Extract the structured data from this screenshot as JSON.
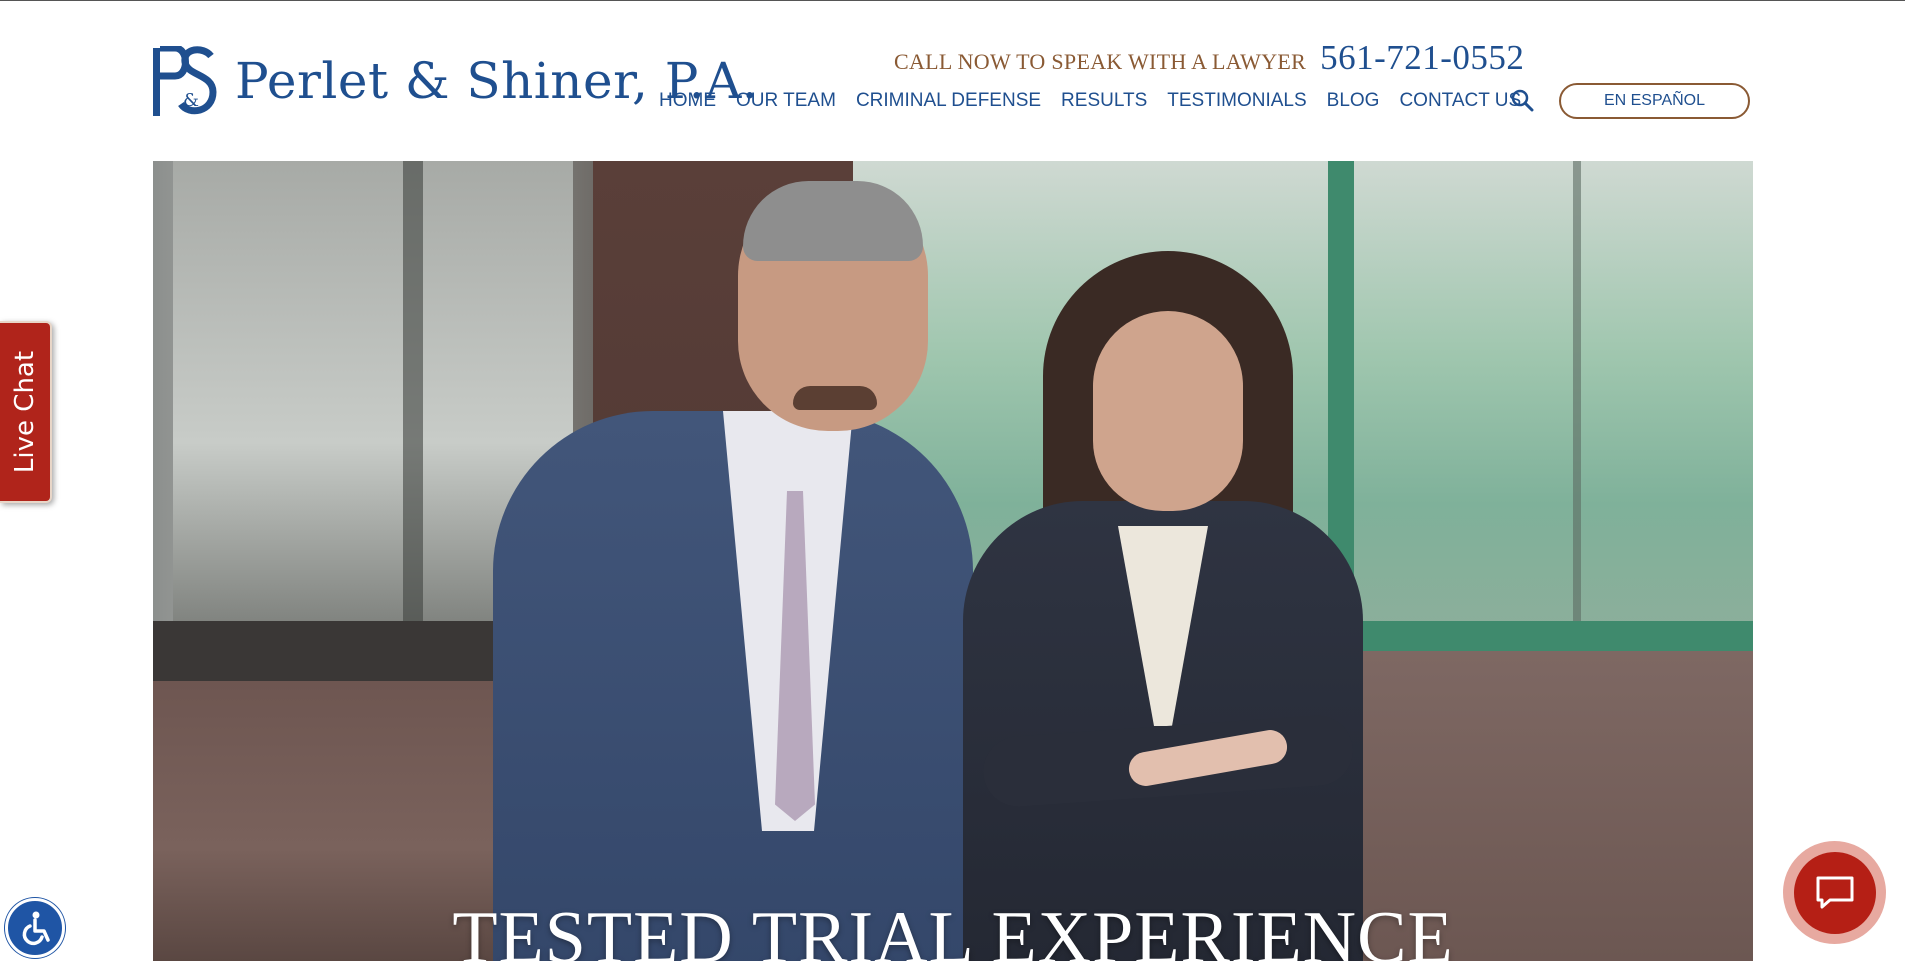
{
  "brand": {
    "name": "Perlet & Shiner, P.A.",
    "monogram": "PS&"
  },
  "contact": {
    "call_label": "CALL NOW TO SPEAK WITH A LAWYER",
    "phone": "561-721-0552"
  },
  "nav": {
    "items": [
      {
        "label": "HOME"
      },
      {
        "label": "OUR TEAM"
      },
      {
        "label": "CRIMINAL DEFENSE"
      },
      {
        "label": "RESULTS"
      },
      {
        "label": "TESTIMONIALS"
      },
      {
        "label": "BLOG"
      },
      {
        "label": "CONTACT US"
      }
    ],
    "search_icon": "search-icon",
    "language_button": "EN ESPAÑOL"
  },
  "hero": {
    "headline": "TESTED TRIAL EXPERIENCE"
  },
  "widgets": {
    "live_chat_label": "Live Chat",
    "accessibility_icon": "wheelchair-icon",
    "chat_icon": "chat-bubble-icon"
  },
  "colors": {
    "brand_blue": "#1f4f8f",
    "accent_brown": "#8a5a34",
    "chat_red": "#b0241b"
  }
}
